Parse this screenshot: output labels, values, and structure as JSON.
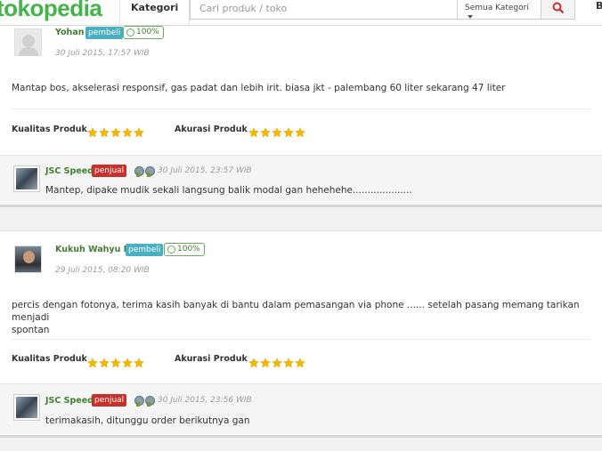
{
  "header": {
    "logo": "tokopedia",
    "kategori": "Kategori",
    "search_placeholder": "Cari produk / toko",
    "category_select": "Semua Kategori",
    "right_item": "B"
  },
  "reviews": [
    {
      "user": "Yohan",
      "role": "pembeli",
      "reputation": "100%",
      "date": "30 Juli 2015, 17:57 WIB",
      "message": "Mantap bos, akselerasi responsif, gas padat dan lebih irit. biasa jkt - palembang 60 liter sekarang 47 liter",
      "quality_label": "Kualitas Produk",
      "quality_stars": 5,
      "accuracy_label": "Akurasi Produk",
      "accuracy_stars": 5,
      "reply": {
        "shop": "JSC Speed",
        "role": "penjual",
        "date": "30 Juli 2015, 23:57 WIB",
        "message": "Mantep, dipake mudik sekali langsung balik modal gan hehehehe...................."
      }
    },
    {
      "user": "Kukuh Wahyu P",
      "role": "pembeli",
      "reputation": "100%",
      "date": "29 Juli 2015, 08:20 WIB",
      "message_line1": "percis dengan fotonya, terima kasih banyak di bantu dalam pemasangan via phone ...... setelah pasang memang tarikan menjadi",
      "message_line2": "spontan",
      "quality_label": "Kualitas Produk",
      "quality_stars": 5,
      "accuracy_label": "Akurasi Produk",
      "accuracy_stars": 5,
      "reply": {
        "shop": "JSC Speed",
        "role": "penjual",
        "date": "30 Juli 2015, 23:56 WIB",
        "message": "terimakasih, ditunggu order berikutnya gan"
      }
    }
  ],
  "colors": {
    "brand_green": "#42b549",
    "name_green": "#3f7f2e",
    "buyer_badge": "#49b0c4",
    "seller_badge": "#c9302c",
    "star": "#f5b800"
  }
}
